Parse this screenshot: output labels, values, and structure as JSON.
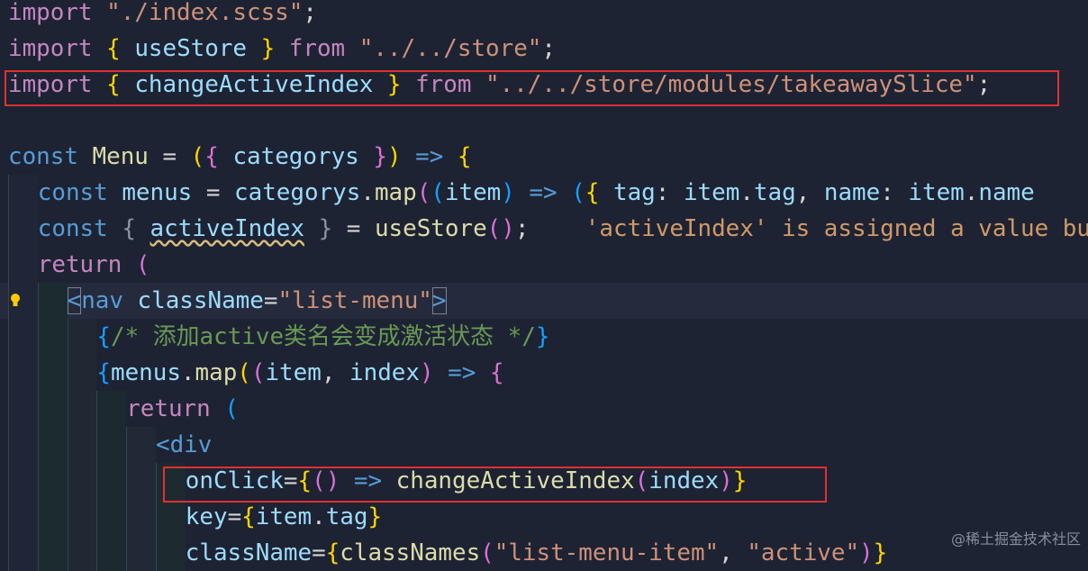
{
  "editor": {
    "lines": [
      {
        "tokens": [
          [
            "kw",
            "import"
          ],
          [
            "plain",
            " "
          ],
          [
            "str",
            "\"./index.scss\""
          ],
          [
            "plain",
            ";"
          ]
        ]
      },
      {
        "tokens": [
          [
            "kw",
            "import"
          ],
          [
            "plain",
            " "
          ],
          [
            "b1",
            "{"
          ],
          [
            "plain",
            " "
          ],
          [
            "var",
            "useStore"
          ],
          [
            "plain",
            " "
          ],
          [
            "b1",
            "}"
          ],
          [
            "plain",
            " "
          ],
          [
            "kw",
            "from"
          ],
          [
            "plain",
            " "
          ],
          [
            "str",
            "\"../../store\""
          ],
          [
            "plain",
            ";"
          ]
        ]
      },
      {
        "tokens": [
          [
            "kw",
            "import"
          ],
          [
            "plain",
            " "
          ],
          [
            "b1",
            "{"
          ],
          [
            "plain",
            " "
          ],
          [
            "var",
            "changeActiveIndex"
          ],
          [
            "plain",
            " "
          ],
          [
            "b1",
            "}"
          ],
          [
            "plain",
            " "
          ],
          [
            "kw",
            "from"
          ],
          [
            "plain",
            " "
          ],
          [
            "str",
            "\"../../store/modules/takeawaySlice\""
          ],
          [
            "plain",
            ";"
          ]
        ]
      },
      {
        "tokens": []
      },
      {
        "tokens": [
          [
            "decl",
            "const"
          ],
          [
            "plain",
            " "
          ],
          [
            "fn",
            "Menu"
          ],
          [
            "plain",
            " "
          ],
          [
            "op",
            "="
          ],
          [
            "plain",
            " "
          ],
          [
            "b1",
            "("
          ],
          [
            "b2",
            "{"
          ],
          [
            "plain",
            " "
          ],
          [
            "var",
            "categorys"
          ],
          [
            "plain",
            " "
          ],
          [
            "b2",
            "}"
          ],
          [
            "b1",
            ")"
          ],
          [
            "plain",
            " "
          ],
          [
            "decl",
            "=>"
          ],
          [
            "plain",
            " "
          ],
          [
            "b1",
            "{"
          ]
        ]
      },
      {
        "tokens": [
          [
            "decl",
            "const"
          ],
          [
            "plain",
            " "
          ],
          [
            "var",
            "menus"
          ],
          [
            "plain",
            " "
          ],
          [
            "op",
            "="
          ],
          [
            "plain",
            " "
          ],
          [
            "var",
            "categorys"
          ],
          [
            "plain",
            "."
          ],
          [
            "fn",
            "map"
          ],
          [
            "b2",
            "("
          ],
          [
            "b3",
            "("
          ],
          [
            "var",
            "item"
          ],
          [
            "b3",
            ")"
          ],
          [
            "plain",
            " "
          ],
          [
            "decl",
            "=>"
          ],
          [
            "plain",
            " "
          ],
          [
            "b3",
            "("
          ],
          [
            "b1",
            "{"
          ],
          [
            "plain",
            " "
          ],
          [
            "var",
            "tag"
          ],
          [
            "plain",
            ": "
          ],
          [
            "var",
            "item"
          ],
          [
            "plain",
            "."
          ],
          [
            "var",
            "tag"
          ],
          [
            "plain",
            ", "
          ],
          [
            "var",
            "name"
          ],
          [
            "plain",
            ": "
          ],
          [
            "var",
            "item"
          ],
          [
            "plain",
            "."
          ],
          [
            "var",
            "name"
          ]
        ]
      },
      {
        "tokens": [
          [
            "decl",
            "const"
          ],
          [
            "plain",
            " "
          ],
          [
            "dim",
            "{"
          ],
          [
            "plain",
            " "
          ],
          [
            "warnvar",
            "activeIndex"
          ],
          [
            "plain",
            " "
          ],
          [
            "dim",
            "}"
          ],
          [
            "plain",
            " "
          ],
          [
            "op",
            "="
          ],
          [
            "plain",
            " "
          ],
          [
            "fn",
            "useStore"
          ],
          [
            "b2",
            "()"
          ],
          [
            "plain",
            ";"
          ],
          [
            "plain",
            "    "
          ],
          [
            "lens",
            "'activeIndex' is assigned a value but never used."
          ]
        ]
      },
      {
        "tokens": [
          [
            "kw",
            "return"
          ],
          [
            "plain",
            " "
          ],
          [
            "b2",
            "("
          ]
        ]
      },
      {
        "tokens": [
          [
            "tag",
            "<"
          ],
          [
            "tag",
            "nav"
          ],
          [
            "plain",
            " "
          ],
          [
            "attr",
            "className"
          ],
          [
            "op",
            "="
          ],
          [
            "str",
            "\"list-menu\""
          ],
          [
            "tag",
            ">"
          ]
        ]
      },
      {
        "tokens": [
          [
            "b3",
            "{"
          ],
          [
            "comment",
            "/* 添加active类名会变成激活状态 */"
          ],
          [
            "b3",
            "}"
          ]
        ]
      },
      {
        "tokens": [
          [
            "b3",
            "{"
          ],
          [
            "var",
            "menus"
          ],
          [
            "plain",
            "."
          ],
          [
            "fn",
            "map"
          ],
          [
            "b1",
            "("
          ],
          [
            "b2",
            "("
          ],
          [
            "var",
            "item"
          ],
          [
            "plain",
            ", "
          ],
          [
            "var",
            "index"
          ],
          [
            "b2",
            ")"
          ],
          [
            "plain",
            " "
          ],
          [
            "decl",
            "=>"
          ],
          [
            "plain",
            " "
          ],
          [
            "b2",
            "{"
          ]
        ]
      },
      {
        "tokens": [
          [
            "kw",
            "return"
          ],
          [
            "plain",
            " "
          ],
          [
            "b3",
            "("
          ]
        ]
      },
      {
        "tokens": [
          [
            "tag",
            "<"
          ],
          [
            "tag",
            "div"
          ]
        ]
      },
      {
        "tokens": [
          [
            "attr",
            "onClick"
          ],
          [
            "op",
            "="
          ],
          [
            "b1",
            "{"
          ],
          [
            "b2",
            "()"
          ],
          [
            "plain",
            " "
          ],
          [
            "decl",
            "=>"
          ],
          [
            "plain",
            " "
          ],
          [
            "fn",
            "changeActiveIndex"
          ],
          [
            "b2",
            "("
          ],
          [
            "var",
            "index"
          ],
          [
            "b2",
            ")"
          ],
          [
            "b1",
            "}"
          ]
        ]
      },
      {
        "tokens": [
          [
            "attr",
            "key"
          ],
          [
            "op",
            "="
          ],
          [
            "b1",
            "{"
          ],
          [
            "var",
            "item"
          ],
          [
            "plain",
            "."
          ],
          [
            "var",
            "tag"
          ],
          [
            "b1",
            "}"
          ]
        ]
      },
      {
        "tokens": [
          [
            "attr",
            "className"
          ],
          [
            "op",
            "="
          ],
          [
            "b1",
            "{"
          ],
          [
            "fn",
            "classNames"
          ],
          [
            "b2",
            "("
          ],
          [
            "str",
            "\"list-menu-item\""
          ],
          [
            "plain",
            ", "
          ],
          [
            "str",
            "\"active\""
          ],
          [
            "b2",
            ")"
          ],
          [
            "b1",
            "}"
          ]
        ]
      }
    ]
  },
  "watermark": "@稀土掘金技术社区"
}
